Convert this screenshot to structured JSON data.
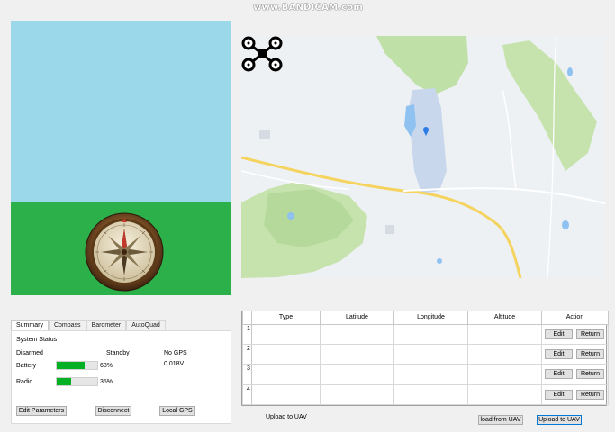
{
  "watermark": "www.BANDICAM.com",
  "attitude": {
    "sky_color": "#9bd8ea",
    "ground_color": "#2bb04a",
    "compass_icon": "compass-icon"
  },
  "map": {
    "vehicle_icon": "quadcopter-icon",
    "marker_icon": "map-pin-icon"
  },
  "tabs": [
    "Summary",
    "Compass",
    "Barometer",
    "AutoQuad"
  ],
  "status": {
    "title": "System Status",
    "armed": "Disarmed",
    "mode": "Standby",
    "gps": "No GPS",
    "voltage": "0.018V",
    "battery_label": "Battery",
    "battery_pct": 68,
    "battery_text": "68%",
    "radio_label": "Radio",
    "radio_pct": 35,
    "radio_text": "35%"
  },
  "panel_buttons": {
    "edit_parameters": "Edit Parameters",
    "disconnect": "Disconnect",
    "local_gps": "Local GPS"
  },
  "waypoints": {
    "columns": [
      "Type",
      "Latitude",
      "Longitude",
      "Altitude",
      "Action"
    ],
    "rows": [
      {
        "num": "1",
        "type": "",
        "lat": "",
        "lon": "",
        "alt": "",
        "edit": "Edit",
        "ret": "Return"
      },
      {
        "num": "2",
        "type": "",
        "lat": "",
        "lon": "",
        "alt": "",
        "edit": "Edit",
        "ret": "Return"
      },
      {
        "num": "3",
        "type": "",
        "lat": "",
        "lon": "",
        "alt": "",
        "edit": "Edit",
        "ret": "Return"
      },
      {
        "num": "4",
        "type": "",
        "lat": "",
        "lon": "",
        "alt": "",
        "edit": "Edit",
        "ret": "Return"
      }
    ]
  },
  "bottom": {
    "upload_label": "Upload to UAV",
    "load_button": "load from UAV",
    "upload_button": "Upload to UAV"
  },
  "colors": {
    "progress": "#06b025",
    "map_green": "#bfe0a6",
    "map_road": "#f4d35e",
    "map_water": "#8fc2f0"
  }
}
